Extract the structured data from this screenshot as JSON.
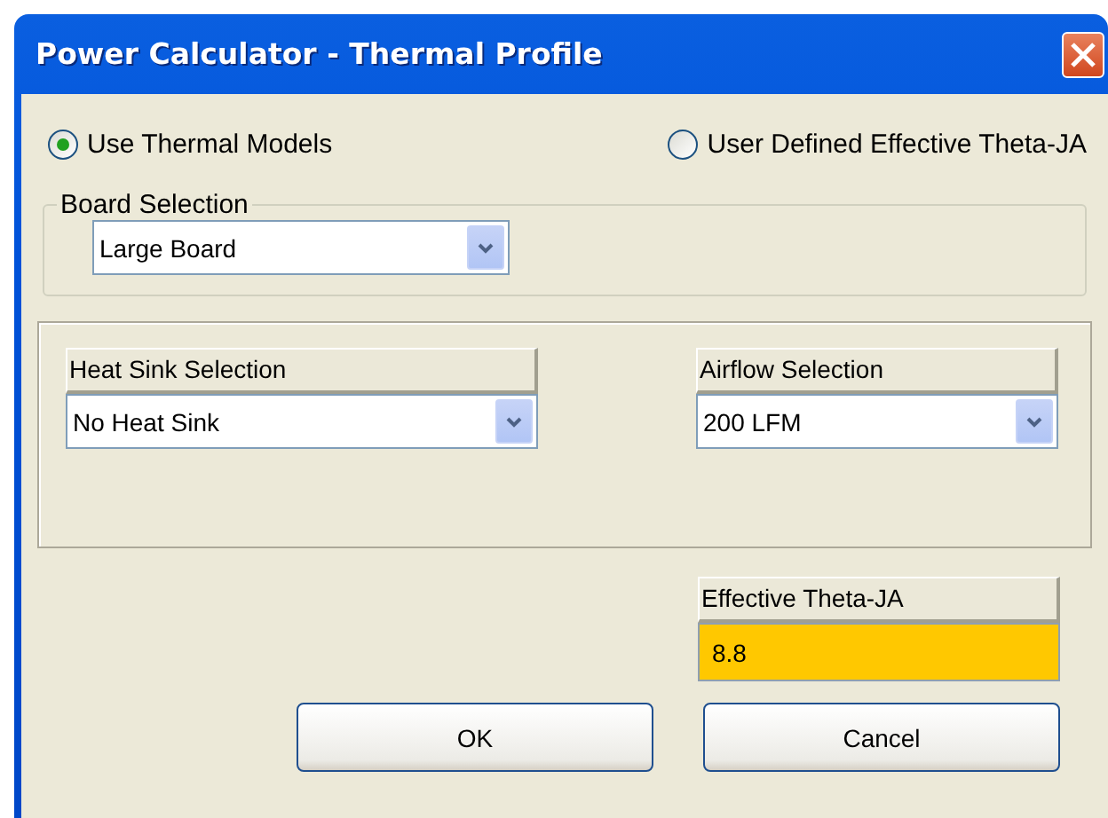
{
  "window": {
    "title": "Power Calculator - Thermal Profile"
  },
  "mode_options": [
    {
      "label": "Use Thermal Models",
      "selected": true
    },
    {
      "label": "User Defined Effective Theta-JA",
      "selected": false
    }
  ],
  "board_selection": {
    "label": "Board Selection",
    "value": "Large Board"
  },
  "heat_sink_selection": {
    "label": "Heat Sink Selection",
    "value": "No Heat Sink"
  },
  "airflow_selection": {
    "label": "Airflow Selection",
    "value": "200 LFM"
  },
  "effective_theta_ja": {
    "label": "Effective Theta-JA",
    "value": "8.8"
  },
  "buttons": [
    "OK",
    "Cancel"
  ]
}
